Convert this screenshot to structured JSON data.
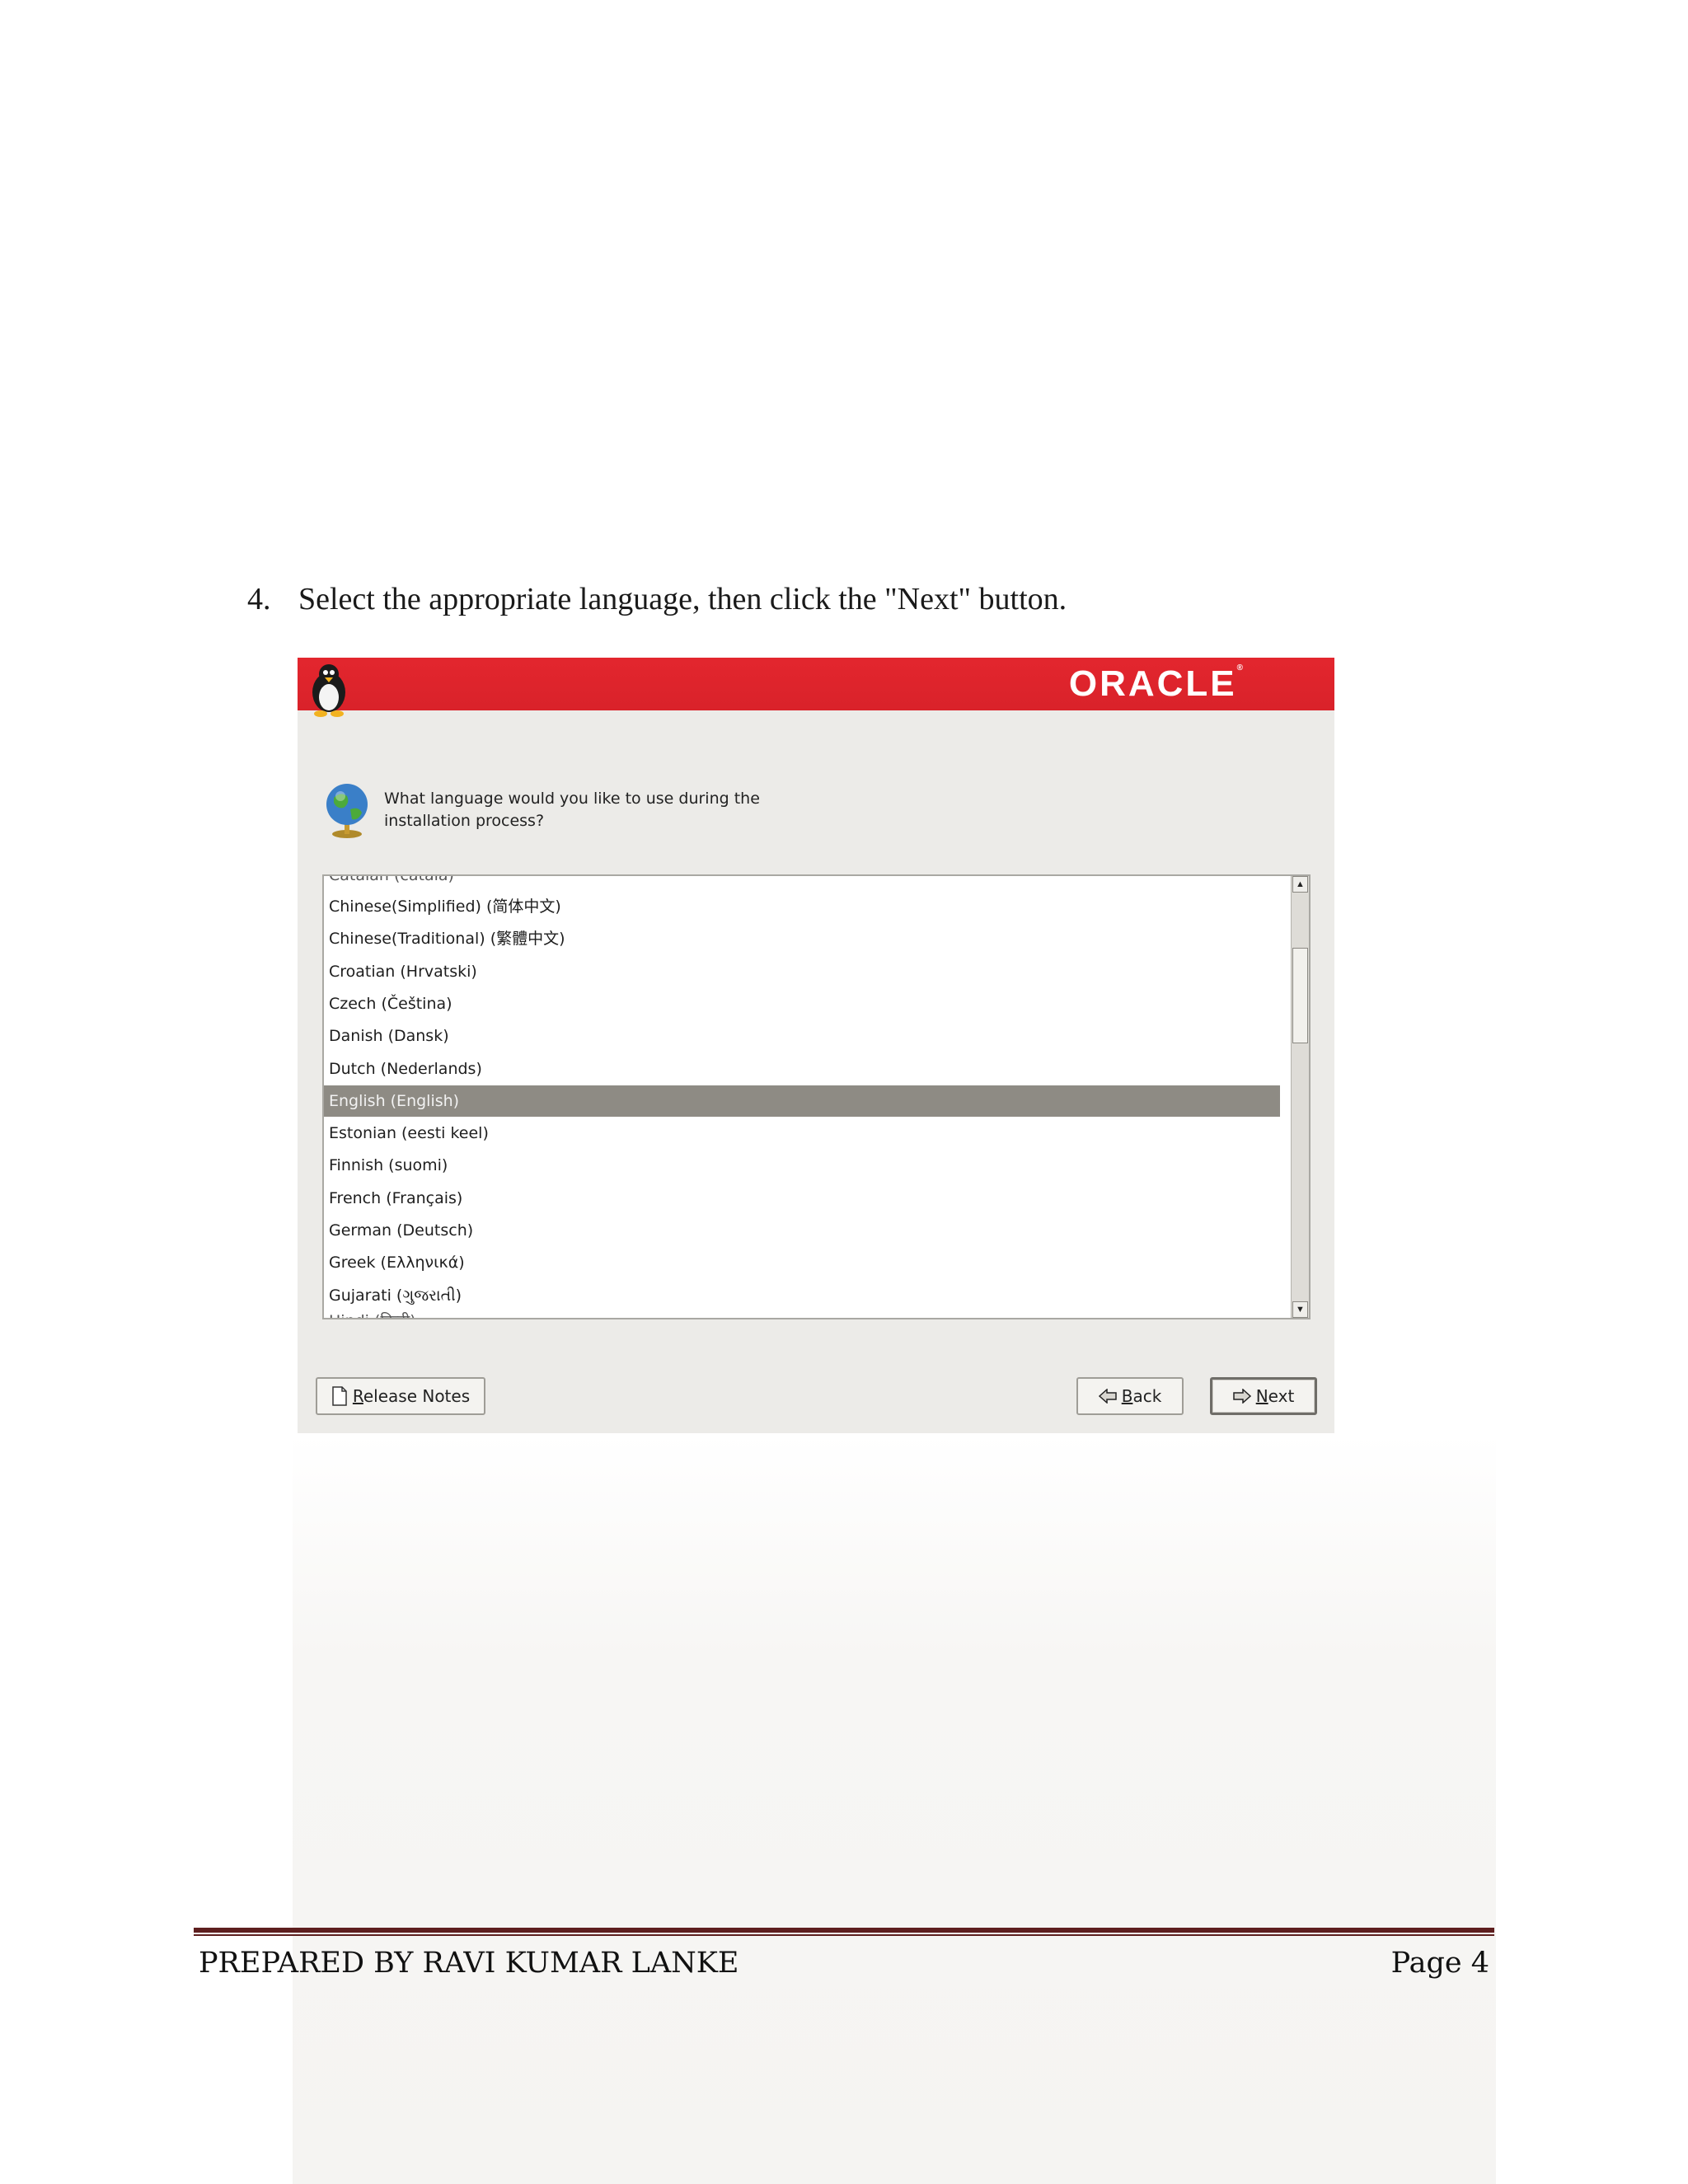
{
  "step": {
    "number": "4.",
    "text": "Select the appropriate language, then click the \"Next\" button."
  },
  "installer": {
    "brand": "ORACLE",
    "question_line1": "What language would you like to use during the",
    "question_line2": "installation process?",
    "languages": [
      "Chinese(Simplified) (简体中文)",
      "Chinese(Traditional) (繁體中文)",
      "Croatian (Hrvatski)",
      "Czech (Čeština)",
      "Danish (Dansk)",
      "Dutch (Nederlands)",
      "English (English)",
      "Estonian (eesti keel)",
      "Finnish (suomi)",
      "French (Français)",
      "German (Deutsch)",
      "Greek (Ελληνικά)",
      "Gujarati (ગુજરાતી)"
    ],
    "selected_language": "English (English)",
    "buttons": {
      "release_notes_mnemonic": "R",
      "release_notes_rest": "elease Notes",
      "back_mnemonic": "B",
      "back_rest": "ack",
      "next_mnemonic": "N",
      "next_rest": "ext"
    }
  },
  "footer": {
    "left": "PREPARED BY RAVI KUMAR LANKE",
    "right": "Page 4"
  },
  "colors": {
    "banner_red": "#e3262e",
    "selection_gray": "#8e8b84",
    "footer_rule": "#5e1f1f"
  },
  "icons": [
    "tux-penguin-icon",
    "globe-icon",
    "document-icon",
    "arrow-left-icon",
    "arrow-right-icon",
    "scroll-up-icon",
    "scroll-down-icon"
  ]
}
